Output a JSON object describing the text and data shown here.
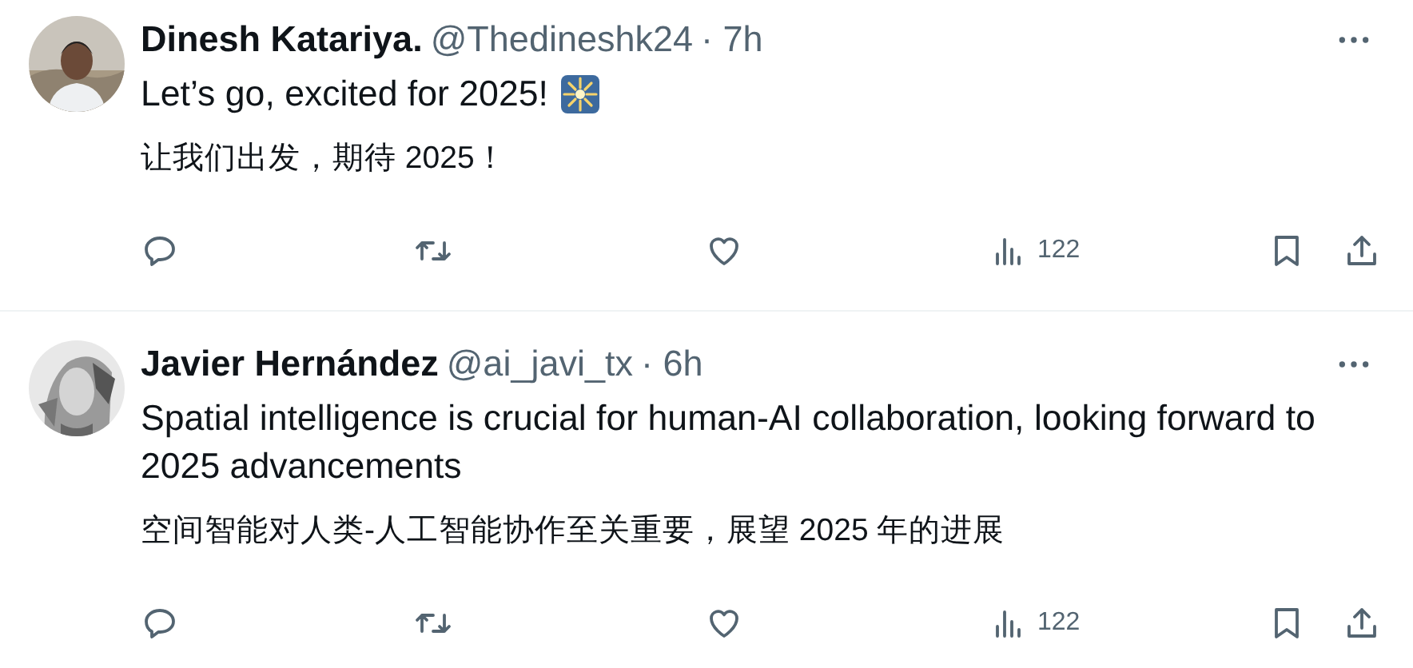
{
  "posts": [
    {
      "name": "Dinesh Katariya.",
      "handle": "@Thedineshk24",
      "time": "· 7h",
      "paragraphs": [
        "Let’s go, excited for 2025!",
        "让我们出发，期待 2025！"
      ],
      "emoji_after_first": true,
      "views": "122"
    },
    {
      "name": "Javier Hernández",
      "handle": "@ai_javi_tx",
      "time": "· 6h",
      "paragraphs": [
        "Spatial intelligence is crucial for human-AI collaboration, looking forward to 2025 advancements",
        "空间智能对人类-人工智能协作至关重要，展望 2025 年的进展"
      ],
      "emoji_after_first": false,
      "views": "122"
    }
  ]
}
